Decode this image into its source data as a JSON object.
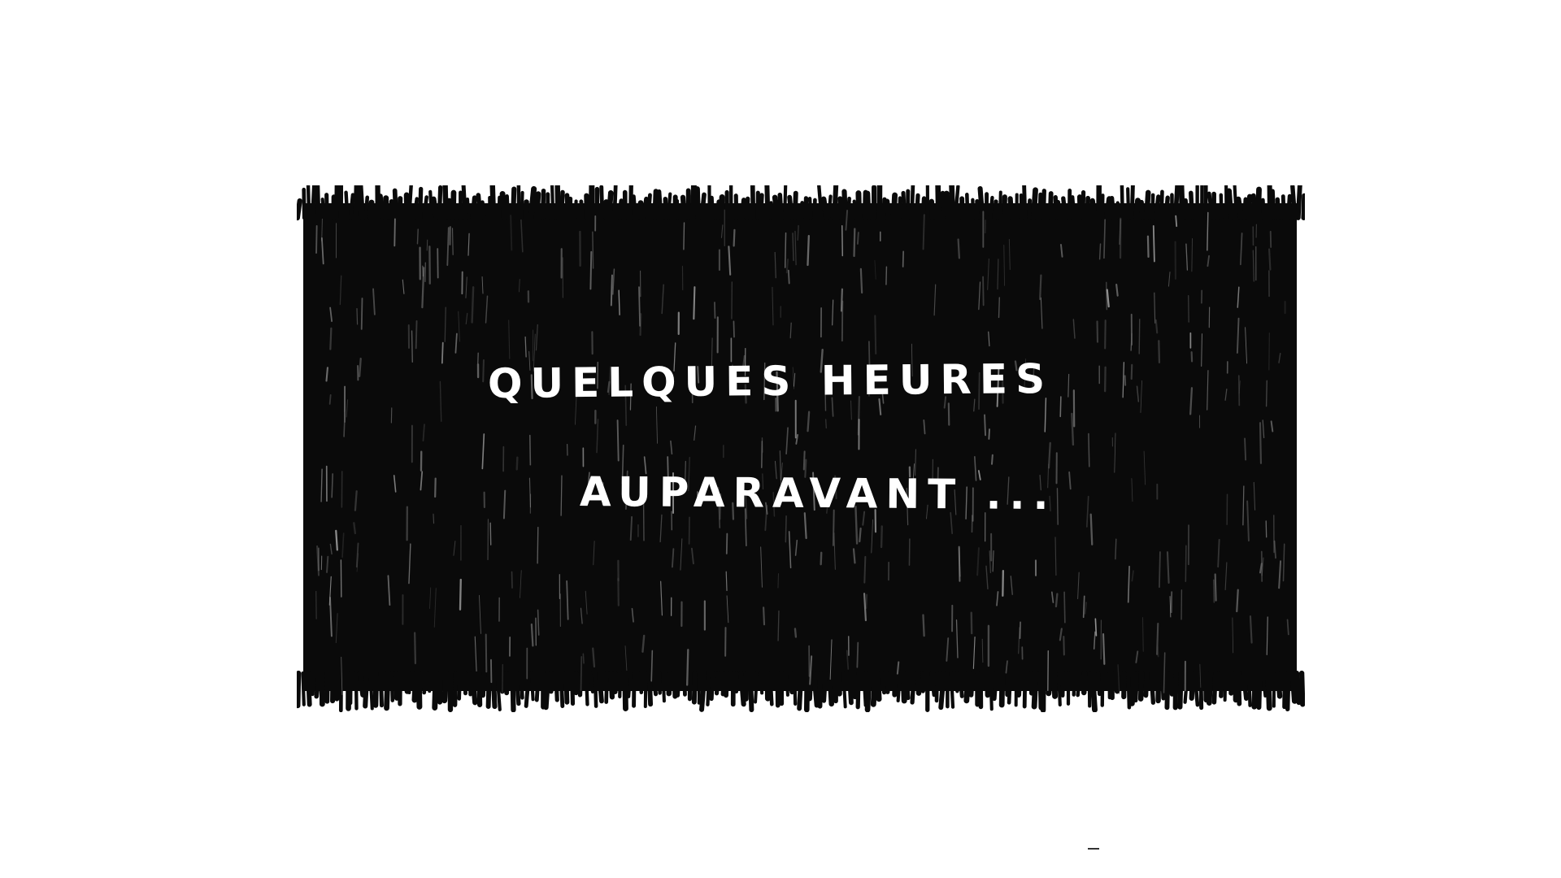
{
  "panel": {
    "caption_line_1": "QUELQUES HEURES",
    "caption_line_2": "AUPARAVANT ...",
    "fill_color": "#0a0a0a",
    "text_color": "#ffffff"
  }
}
